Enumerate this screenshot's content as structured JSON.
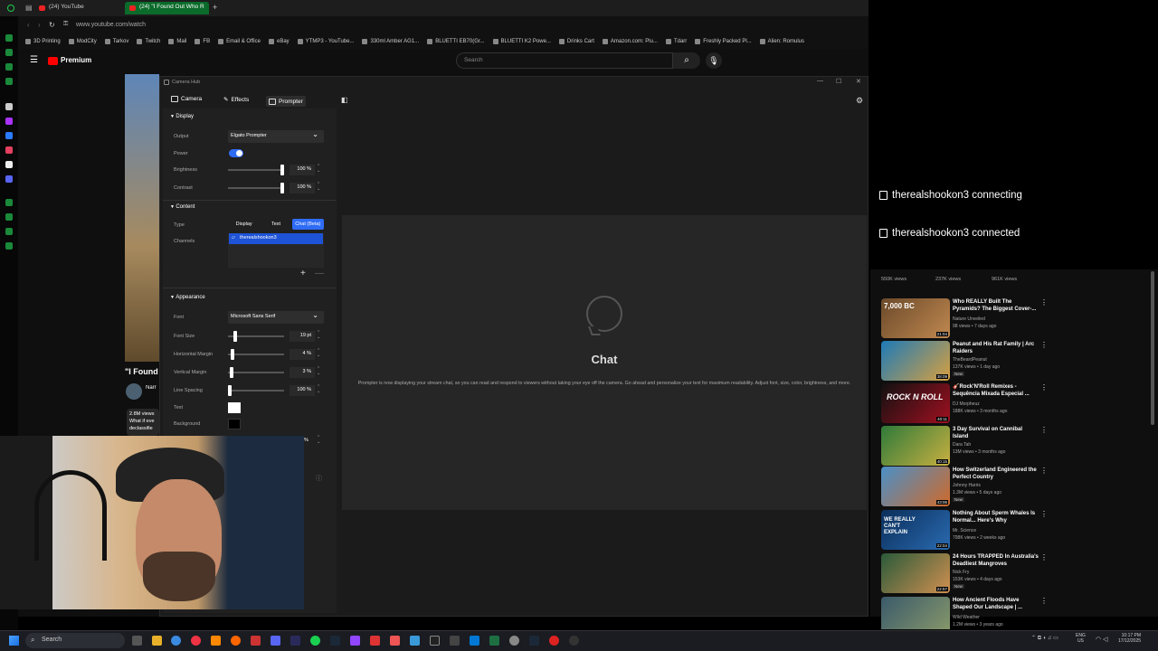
{
  "browser": {
    "tabs": [
      {
        "label": "(24) YouTube"
      },
      {
        "label": "(24) \"I Found Out Who R"
      }
    ],
    "new_tab": "+",
    "url": "www.youtube.com/watch",
    "bookmarks": [
      "3D Printing",
      "ModCity",
      "Tarkov",
      "Twitch",
      "Mail",
      "FB",
      "Email & Office",
      "eBay",
      "YTMP3 - YouTube...",
      "330ml Amber AG1...",
      "BLUETTI EB70(Gr...",
      "BLUETTI K2 Powe...",
      "Drinks Cart",
      "Amazon.com: Plu...",
      "Tdarr",
      "Freshly Packed Pl...",
      "Alien: Romulus"
    ]
  },
  "youtube": {
    "logo": "Premium",
    "search_placeholder": "Search",
    "video_title": "\"I Found O",
    "channel_initial": "Narr",
    "views": "2.8M views",
    "desc1": "What if eve",
    "desc2": "declassifie"
  },
  "camera_hub": {
    "title": "Camera Hub",
    "tabs": [
      "Camera",
      "Effects",
      "Prompter"
    ],
    "display": {
      "section": "Display",
      "output_label": "Output",
      "output_value": "Elgato Prompter",
      "power_label": "Power",
      "power_on": true,
      "brightness_label": "Brightness",
      "brightness_value": "100 %",
      "contrast_label": "Contrast",
      "contrast_value": "100 %"
    },
    "content": {
      "section": "Content",
      "type_label": "Type",
      "type_options": [
        "Display",
        "Text",
        "Chat (Beta)"
      ],
      "type_selected": "Chat (Beta)",
      "channels_label": "Channels",
      "channel": "therealshookon3",
      "add": "+",
      "remove": "—"
    },
    "appearance": {
      "section": "Appearance",
      "font_label": "Font",
      "font_value": "Microsoft Sans Serif",
      "font_size_label": "Font Size",
      "font_size_value": "19 pt",
      "hmargin_label": "Horizontal Margin",
      "hmargin_value": "4 %",
      "vmargin_label": "Vertical Margin",
      "vmargin_value": "3 %",
      "spacing_label": "Line Spacing",
      "spacing_value": "100 %",
      "text_label": "Text",
      "text_color": "#ffffff",
      "bg_label": "Background",
      "bg_color": "#000000",
      "partial_value": "%"
    },
    "preview": {
      "title": "Chat",
      "description": "Prompter is now displaying your stream chat, so you can read and respond to viewers without taking your eye off the camera. Go ahead and personalize your text for maximum readability. Adjust font, size, color, brightness, and more."
    }
  },
  "chat_overlay": [
    "therealshookon3 connecting",
    "therealshookon3 connected"
  ],
  "recommendations": {
    "top_row_views": [
      "550K views",
      "237K views",
      "961K views"
    ],
    "items": [
      {
        "title": "Who REALLY Built The Pyramids? The Biggest Cover-...",
        "channel": "Nature Unveiled",
        "meta": "98 views • 7 days ago",
        "duration": "21:04",
        "new": false,
        "overlay": "7,000 BC"
      },
      {
        "title": "Peanut and His Rat Family | Arc Raiders",
        "channel": "TheBeardPeanut",
        "meta": "137K views • 1 day ago",
        "duration": "38:09",
        "new": true
      },
      {
        "title": "🎸Rock'N'Roll Remixes - Sequência Mixada Especial ...",
        "channel": "DJ Morpheuz",
        "meta": "188K views • 3 months ago",
        "duration": "40:11",
        "new": false,
        "overlay": "ROCK N ROLL"
      },
      {
        "title": "3 Day Survival on Cannibal Island",
        "channel": "Dara Tah",
        "meta": "13M views • 3 months ago",
        "duration": "40:15",
        "new": false
      },
      {
        "title": "How Switzerland Engineered the Perfect Country",
        "channel": "Johnny Harris",
        "meta": "1.3M views • 5 days ago",
        "duration": "43:06",
        "new": true
      },
      {
        "title": "Nothing About Sperm Whales Is Normal... Here's Why",
        "channel": "Mr. Science",
        "meta": "798K views • 2 weeks ago",
        "duration": "22:04",
        "new": false,
        "overlay": "WE REALLY CAN'T EXPLAIN"
      },
      {
        "title": "24 Hours TRAPPED In Australia's Deadliest Mangroves",
        "channel": "Nick Fry",
        "meta": "153K views • 4 days ago",
        "duration": "22:57",
        "new": true
      },
      {
        "title": "How Ancient Floods Have Shaped Our Landscape | ...",
        "channel": "Wild Weather",
        "meta": "1.2M views • 3 years ago",
        "duration": "",
        "new": false
      }
    ],
    "new_badge": "New"
  },
  "taskbar": {
    "search": "Search",
    "lang": [
      "ENG",
      "US"
    ],
    "time": "10:17 PM",
    "date": "17/12/2025"
  }
}
